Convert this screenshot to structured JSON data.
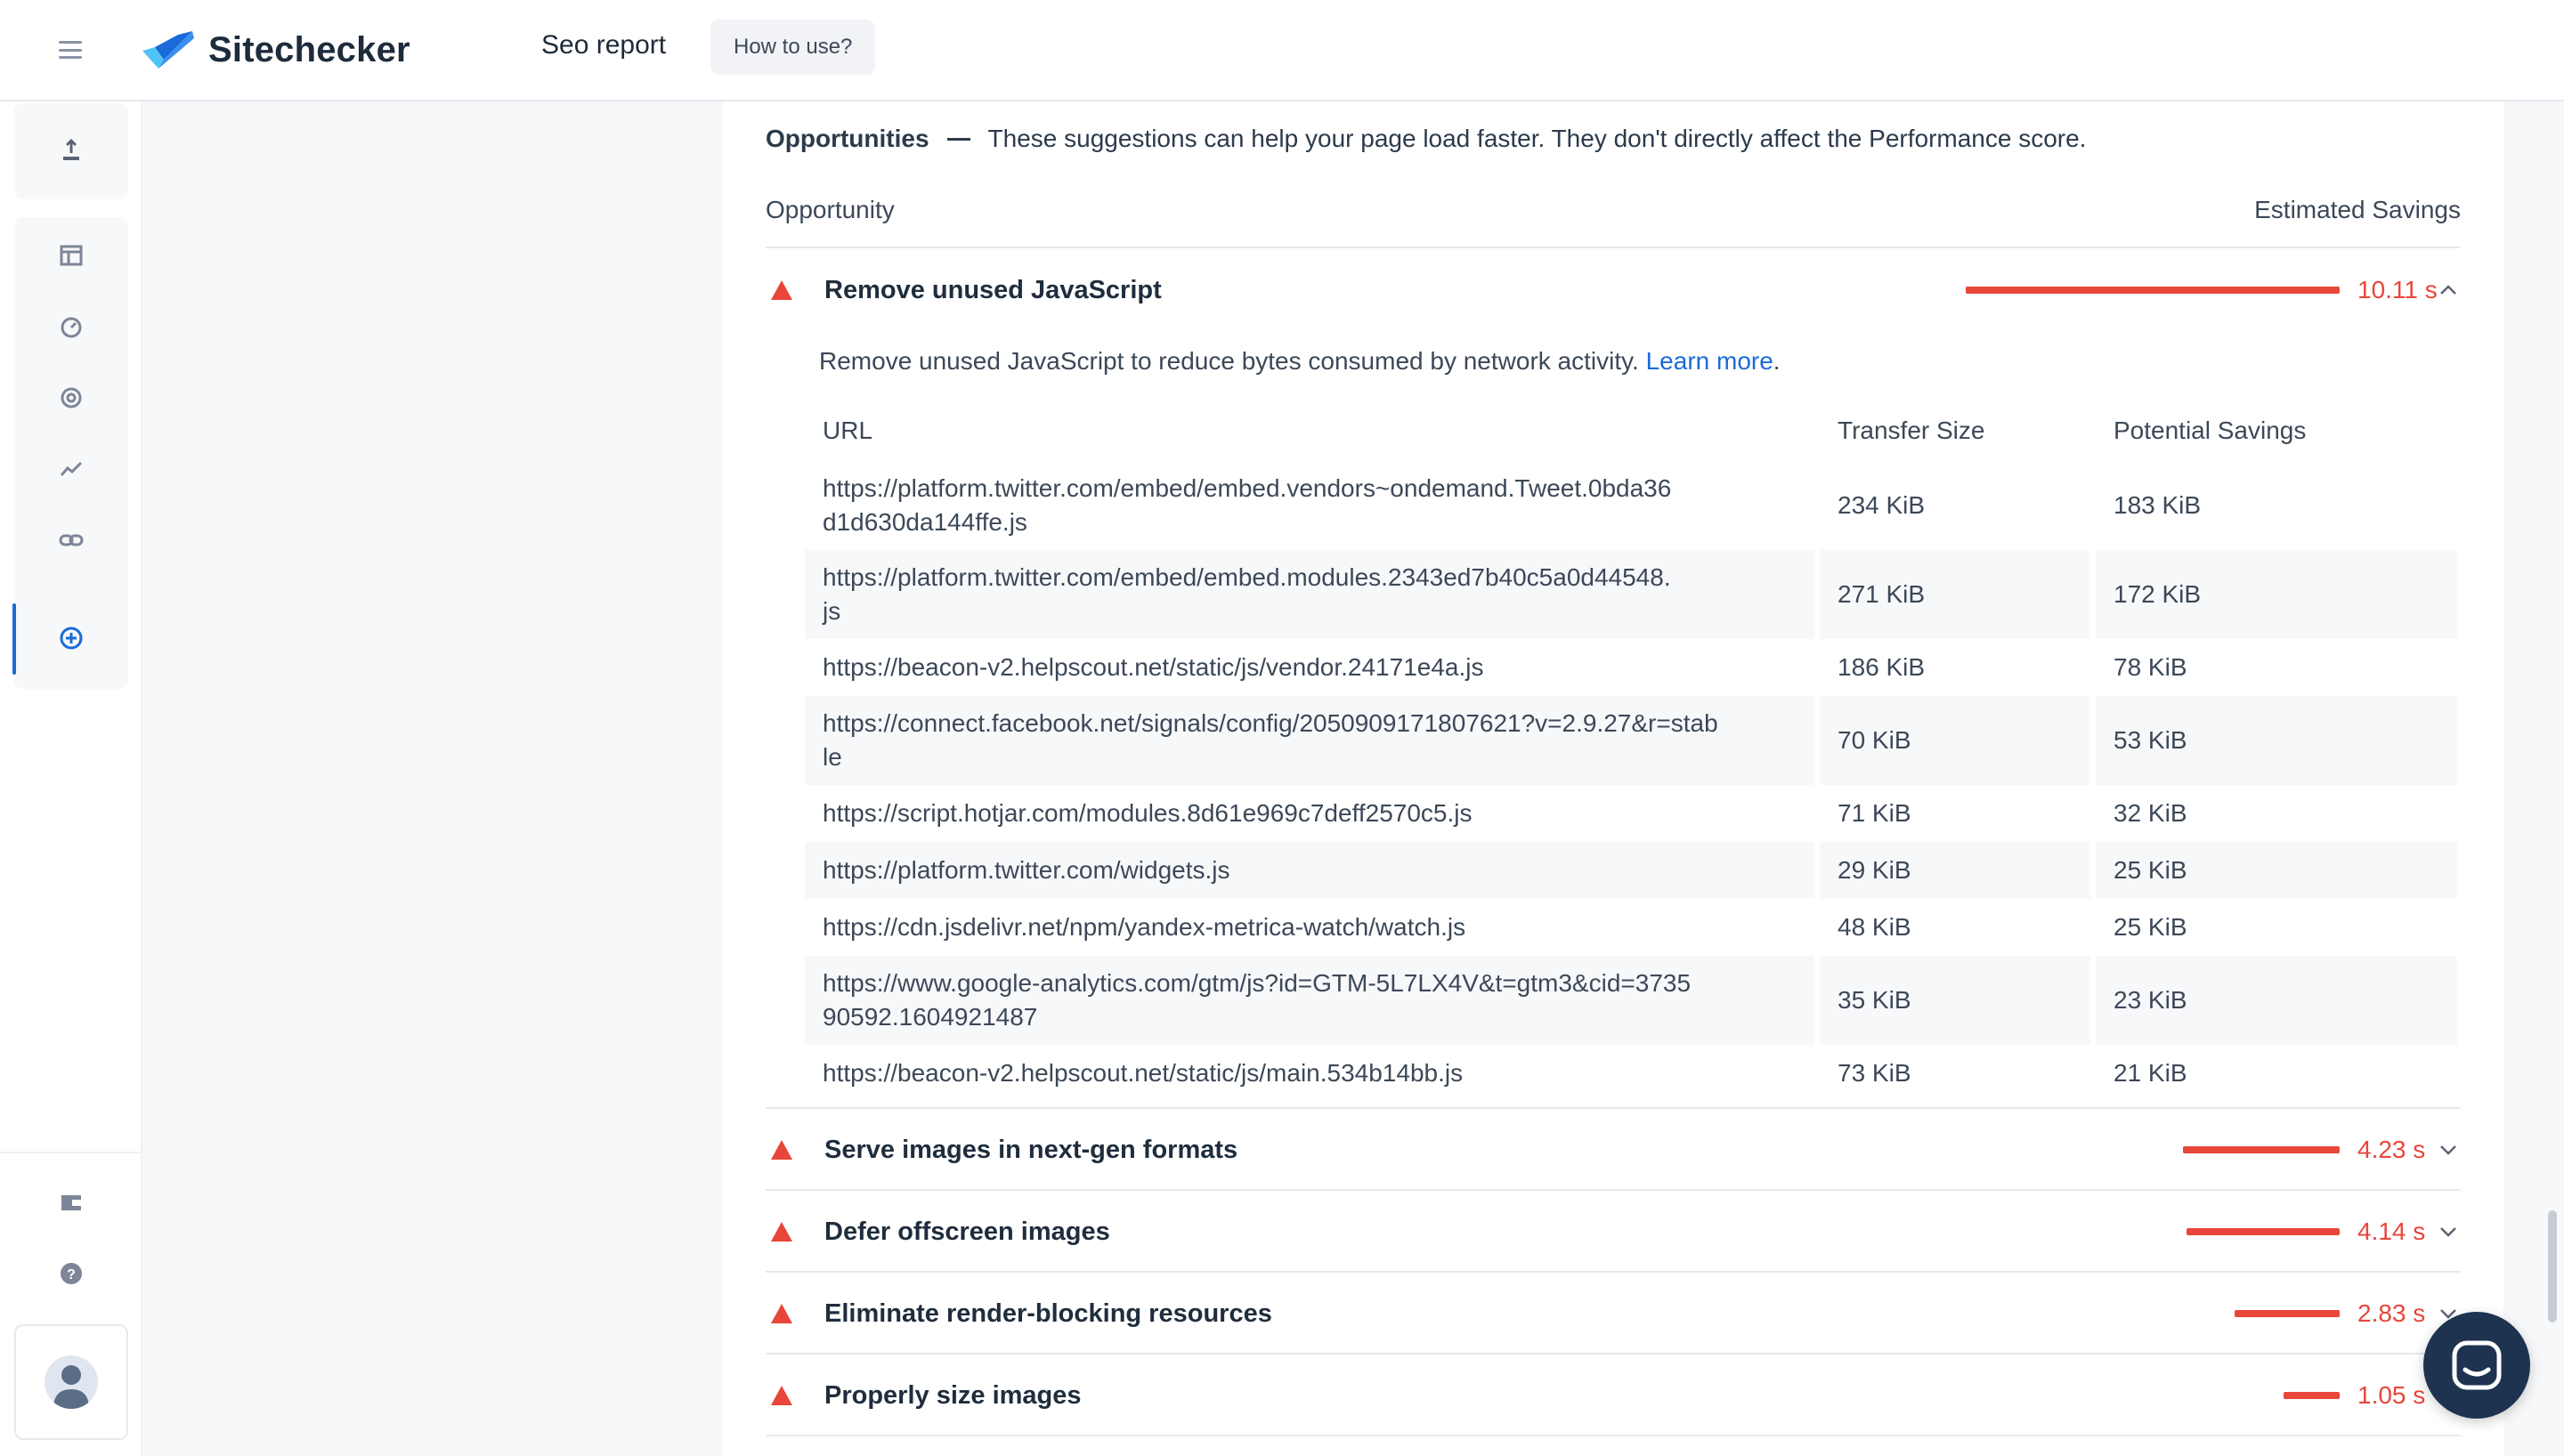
{
  "header": {
    "brand": "Sitechecker",
    "page_name": "Seo report",
    "howto_label": "How to use?"
  },
  "sidebar": {
    "top_icon": "upload-icon",
    "items": [
      {
        "icon": "table-icon"
      },
      {
        "icon": "speedometer-icon"
      },
      {
        "icon": "target-icon"
      },
      {
        "icon": "trend-icon"
      },
      {
        "icon": "link-icon"
      },
      {
        "icon": "plus-circle-icon",
        "active": true
      }
    ],
    "bottom_items": [
      {
        "icon": "wallet-icon"
      },
      {
        "icon": "help-icon"
      }
    ]
  },
  "opportunities": {
    "title": "Opportunities",
    "subtitle": "These suggestions can help your page load faster. They don't directly affect the Performance score.",
    "col_left": "Opportunity",
    "col_right": "Estimated Savings",
    "expanded": {
      "title": "Remove unused JavaScript",
      "saving": "10.11 s",
      "saving_fraction": 1.0,
      "description": "Remove unused JavaScript to reduce bytes consumed by network activity.",
      "learn_more": "Learn more",
      "table": {
        "headers": [
          "URL",
          "Transfer Size",
          "Potential Savings"
        ],
        "rows": [
          {
            "url1": "https://platform.twitter.com/embed/embed.vendors~ondemand.Tweet.0bda36",
            "url2": "d1d630da144ffe.js",
            "size": "234 KiB",
            "savings": "183 KiB"
          },
          {
            "url1": "https://platform.twitter.com/embed/embed.modules.2343ed7b40c5a0d44548.",
            "url2": "js",
            "size": "271 KiB",
            "savings": "172 KiB"
          },
          {
            "url1": "https://beacon-v2.helpscout.net/static/js/vendor.24171e4a.js",
            "url2": "",
            "size": "186 KiB",
            "savings": "78 KiB"
          },
          {
            "url1": "https://connect.facebook.net/signals/config/2050909171807621?v=2.9.27&r=stab",
            "url2": "le",
            "size": "70 KiB",
            "savings": "53 KiB"
          },
          {
            "url1": "https://script.hotjar.com/modules.8d61e969c7deff2570c5.js",
            "url2": "",
            "size": "71 KiB",
            "savings": "32 KiB"
          },
          {
            "url1": "https://platform.twitter.com/widgets.js",
            "url2": "",
            "size": "29 KiB",
            "savings": "25 KiB"
          },
          {
            "url1": "https://cdn.jsdelivr.net/npm/yandex-metrica-watch/watch.js",
            "url2": "",
            "size": "48 KiB",
            "savings": "25 KiB"
          },
          {
            "url1": "https://www.google-analytics.com/gtm/js?id=GTM-5L7LX4V&t=gtm3&cid=3735",
            "url2": "90592.1604921487",
            "size": "35 KiB",
            "savings": "23 KiB"
          },
          {
            "url1": "https://beacon-v2.helpscout.net/static/js/main.534b14bb.js",
            "url2": "",
            "size": "73 KiB",
            "savings": "21 KiB"
          }
        ]
      }
    },
    "collapsed": [
      {
        "title": "Serve images in next-gen formats",
        "saving": "4.23 s",
        "saving_fraction": 0.42
      },
      {
        "title": "Defer offscreen images",
        "saving": "4.14 s",
        "saving_fraction": 0.41
      },
      {
        "title": "Eliminate render-blocking resources",
        "saving": "2.83 s",
        "saving_fraction": 0.28
      },
      {
        "title": "Properly size images",
        "saving": "1.05 s",
        "saving_fraction": 0.15
      }
    ]
  },
  "colors": {
    "accent": "#1a6bd8",
    "fail": "#e8463a",
    "chat": "#1e3350"
  },
  "chat_icon": "chat-icon"
}
